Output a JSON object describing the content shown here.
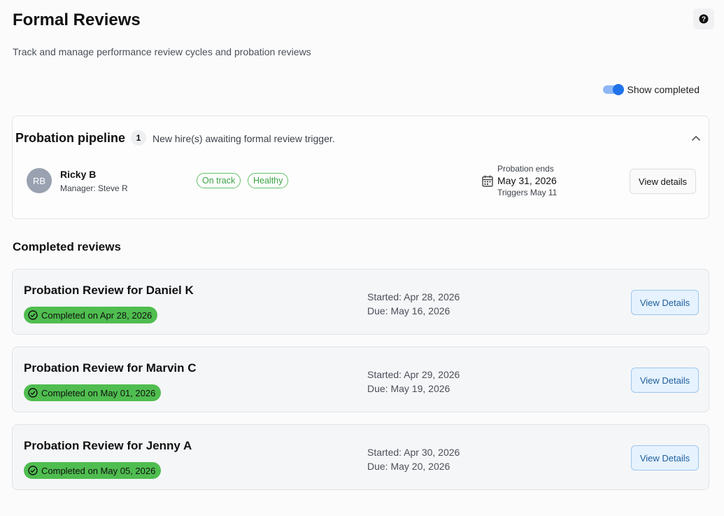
{
  "header": {
    "title": "Formal Reviews",
    "subtitle": "Track and manage performance review cycles and probation reviews",
    "help_icon": "question-circle-icon"
  },
  "toggle": {
    "label": "Show completed",
    "on": true,
    "accent": "#1f72ea"
  },
  "pipeline": {
    "title": "Probation pipeline",
    "count": "1",
    "description": "New hire(s) awaiting formal review trigger.",
    "employee": {
      "initials": "RB",
      "name": "Ricky B",
      "manager": "Manager: Steve R",
      "tags": [
        "On track",
        "Healthy"
      ],
      "probation_label": "Probation ends",
      "probation_date": "May 31, 2026",
      "trigger": "Triggers May 11",
      "button": "View details"
    }
  },
  "completed": {
    "title": "Completed reviews",
    "items": [
      {
        "title": "Probation Review for Daniel K",
        "badge": "Completed on Apr 28, 2026",
        "started": "Started: Apr 28, 2026",
        "due": "Due: May 16, 2026",
        "button": "View Details"
      },
      {
        "title": "Probation Review for Marvin C",
        "badge": "Completed on May 01, 2026",
        "started": "Started: Apr 29, 2026",
        "due": "Due: May 19, 2026",
        "button": "View Details"
      },
      {
        "title": "Probation Review for Jenny A",
        "badge": "Completed on May 05, 2026",
        "started": "Started: Apr 30, 2026",
        "due": "Due: May 20, 2026",
        "button": "View Details"
      }
    ]
  },
  "colors": {
    "success": "#4fbd4f",
    "tag_green": "#3aa345",
    "link_blue": "#1f5f9e"
  }
}
